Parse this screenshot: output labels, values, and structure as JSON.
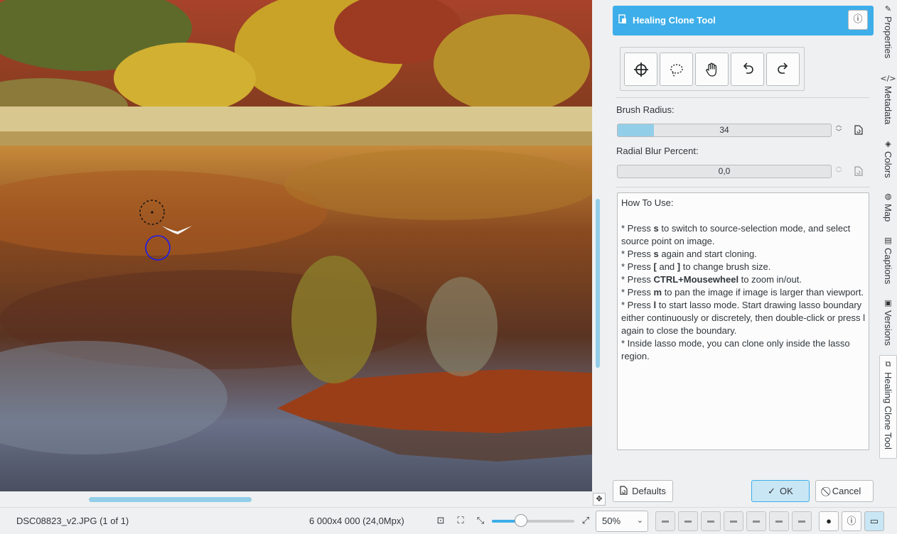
{
  "canvas": {
    "image_name": "autumn lake photo",
    "source_cursor": "source-circle-cursor",
    "target_cursor": "target-circle-cursor"
  },
  "tool": {
    "title": "Healing Clone Tool",
    "header_icon": "healing-clone-icon",
    "info_icon": "info-icon",
    "toolbar": [
      {
        "name": "select-source-button",
        "icon": "crosshair-icon"
      },
      {
        "name": "lasso-button",
        "icon": "lasso-icon"
      },
      {
        "name": "move-image-button",
        "icon": "hand-icon"
      },
      {
        "name": "undo-button",
        "icon": "undo-icon"
      },
      {
        "name": "redo-button",
        "icon": "redo-icon"
      }
    ],
    "brush_radius_label": "Brush Radius:",
    "brush_radius_value": "34",
    "brush_radius_fraction": 0.17,
    "radial_blur_label": "Radial Blur Percent:",
    "radial_blur_value": "0,0",
    "radial_blur_fraction": 0.0,
    "howto": [
      {
        "type": "text",
        "parts": [
          {
            "t": "How To Use:"
          }
        ]
      },
      {
        "type": "blank"
      },
      {
        "type": "text",
        "parts": [
          {
            "t": "* Press "
          },
          {
            "t": "s",
            "b": true
          },
          {
            "t": " to switch to source-selection mode, and select source point on image."
          }
        ]
      },
      {
        "type": "text",
        "parts": [
          {
            "t": "* Press "
          },
          {
            "t": "s",
            "b": true
          },
          {
            "t": " again and start cloning."
          }
        ]
      },
      {
        "type": "text",
        "parts": [
          {
            "t": "* Press "
          },
          {
            "t": "[ ",
            "b": true
          },
          {
            "t": "and "
          },
          {
            "t": "]",
            "b": true
          },
          {
            "t": " to change brush size."
          }
        ]
      },
      {
        "type": "text",
        "parts": [
          {
            "t": "* Press "
          },
          {
            "t": "CTRL+Mousewheel",
            "b": true
          },
          {
            "t": " to zoom in/out."
          }
        ]
      },
      {
        "type": "text",
        "parts": [
          {
            "t": "* Press "
          },
          {
            "t": "m",
            "b": true
          },
          {
            "t": " to pan the image if image is larger than viewport."
          }
        ]
      },
      {
        "type": "text",
        "parts": [
          {
            "t": "* Press "
          },
          {
            "t": "l",
            "b": true
          },
          {
            "t": " to start lasso mode. Start drawing lasso boundary either continuously or discretely, then double-click or press l again to close the boundary."
          }
        ]
      },
      {
        "type": "text",
        "parts": [
          {
            "t": "* Inside lasso mode, you can clone only inside the lasso region."
          }
        ]
      }
    ],
    "defaults_label": "Defaults",
    "ok_label": "OK",
    "cancel_label": "Cancel"
  },
  "sidetabs": [
    {
      "label": "Properties",
      "icon": "properties-icon",
      "active": false
    },
    {
      "label": "Metadata",
      "icon": "metadata-icon",
      "active": false
    },
    {
      "label": "Colors",
      "icon": "colors-icon",
      "active": false
    },
    {
      "label": "Map",
      "icon": "globe-icon",
      "active": false
    },
    {
      "label": "Captions",
      "icon": "captions-icon",
      "active": false
    },
    {
      "label": "Versions",
      "icon": "versions-icon",
      "active": false
    },
    {
      "label": "Healing Clone Tool",
      "icon": "healing-clone-icon",
      "active": true
    }
  ],
  "status": {
    "filename": "DSC08823_v2.JPG (1 of 1)",
    "dimensions": "6 000x4 000 (24,0Mpx)",
    "zoom_value": "50%",
    "zoom_fraction": 0.35
  }
}
